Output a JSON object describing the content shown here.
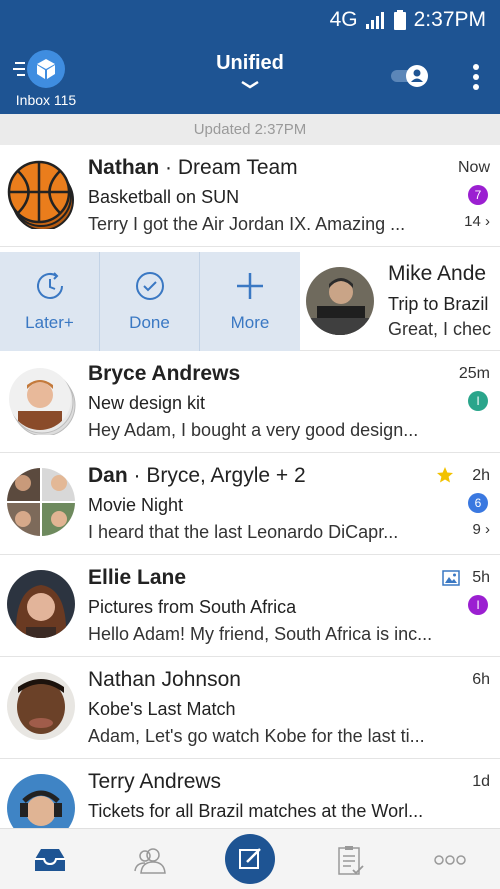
{
  "status_bar": {
    "network": "4G",
    "time": "2:37PM"
  },
  "header": {
    "inbox_label": "Inbox 115",
    "title": "Unified"
  },
  "updated_text": "Updated 2:37PM",
  "colors": {
    "brand": "#1e5493",
    "accent": "#3f8de0",
    "action_tint": "#3a78c3"
  },
  "emails": [
    {
      "sender": "Nathan",
      "group": "Dream Team",
      "subject": "Basketball on SUN",
      "preview": "Terry I got the Air Jordan IX. Amazing ...",
      "time": "Now",
      "badge": "7",
      "badge_color": "#9b1fd1",
      "thread": "14 ›"
    },
    {
      "sender": "Bryce Andrews",
      "subject": "New design kit",
      "preview": "Hey Adam, I bought a very good design...",
      "time": "25m",
      "badge": "I",
      "badge_color": "#2aa58b"
    },
    {
      "sender": "Dan",
      "group": "Bryce, Argyle + 2",
      "subject": "Movie Night",
      "preview": "I heard that the last Leonardo DiCapr...",
      "time": "2h",
      "badge": "6",
      "badge_color": "#3a78e0",
      "thread": "9 ›"
    },
    {
      "sender": "Ellie Lane",
      "subject": "Pictures from South Africa",
      "preview": "Hello Adam! My friend, South Africa is inc...",
      "time": "5h",
      "badge": "I",
      "badge_color": "#9b1fd1"
    },
    {
      "sender": "Nathan Johnson",
      "subject": "Kobe's Last Match",
      "preview": "Adam, Let's go watch Kobe for the last ti...",
      "time": "6h"
    },
    {
      "sender": "Terry Andrews",
      "subject": "Tickets for all Brazil matches at the Worl...",
      "time": "1d"
    }
  ],
  "swiped_email": {
    "sender": "Mike Ande",
    "subject": "Trip to Brazil",
    "preview": "Great, I chec"
  },
  "swipe_actions": [
    {
      "label": "Later+",
      "icon": "clock-icon"
    },
    {
      "label": "Done",
      "icon": "check-circle-icon"
    },
    {
      "label": "More",
      "icon": "plus-icon"
    }
  ],
  "bottom_nav": [
    {
      "name": "inbox-icon"
    },
    {
      "name": "people-icon"
    },
    {
      "name": "compose-icon"
    },
    {
      "name": "clipboard-icon"
    },
    {
      "name": "more-icon"
    }
  ]
}
